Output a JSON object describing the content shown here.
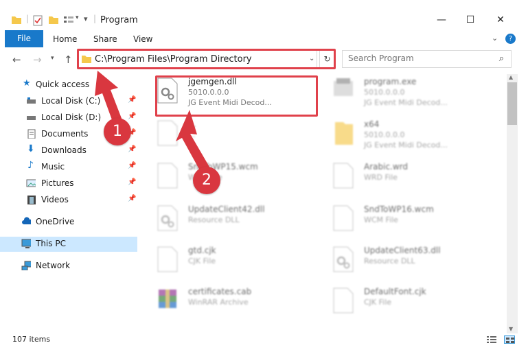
{
  "window": {
    "title": "Program",
    "minimize_glyph": "—",
    "maximize_glyph": "☐",
    "close_glyph": "✕"
  },
  "ribbon": {
    "file": "File",
    "home": "Home",
    "share": "Share",
    "view": "View"
  },
  "address": {
    "path": "C:\\Program Files\\Program Directory"
  },
  "search": {
    "placeholder": "Search Program"
  },
  "sidebar": {
    "quick_access": "Quick access",
    "local_c": "Local Disk (C:)",
    "local_d": "Local Disk (D:)",
    "documents": "Documents",
    "downloads": "Downloads",
    "music": "Music",
    "pictures": "Pictures",
    "videos": "Videos",
    "onedrive": "OneDrive",
    "this_pc": "This PC",
    "network": "Network"
  },
  "files": [
    {
      "name": "jgemgen.dll",
      "line2": "5010.0.0.0",
      "line3": "JG Event Midi Decod..."
    },
    {
      "name": "program.exe",
      "line2": "5010.0.0.0",
      "line3": "JG Event Midi Decod..."
    },
    {
      "name": "...",
      "line2": "...",
      "line3": ""
    },
    {
      "name": "x64",
      "line2": "5010.0.0.0",
      "line3": "JG Event Midi Decod..."
    },
    {
      "name": "SndToWP15.wcm",
      "line2": "WCM File",
      "line3": ""
    },
    {
      "name": "Arabic.wrd",
      "line2": "WRD File",
      "line3": ""
    },
    {
      "name": "UpdateClient42.dll",
      "line2": "Resource DLL",
      "line3": ""
    },
    {
      "name": "SndToWP16.wcm",
      "line2": "WCM File",
      "line3": ""
    },
    {
      "name": "gtd.cjk",
      "line2": "CJK File",
      "line3": ""
    },
    {
      "name": "UpdateClient63.dll",
      "line2": "Resource DLL",
      "line3": ""
    },
    {
      "name": "certificates.cab",
      "line2": "WinRAR Archive",
      "line3": ""
    },
    {
      "name": "DefaultFont.cjk",
      "line2": "CJK File",
      "line3": ""
    }
  ],
  "status": {
    "items": "107 items"
  },
  "badges": {
    "one": "1",
    "two": "2"
  },
  "colors": {
    "accent": "#1979ca",
    "highlight": "#e0414b",
    "selection": "#cce8ff"
  }
}
